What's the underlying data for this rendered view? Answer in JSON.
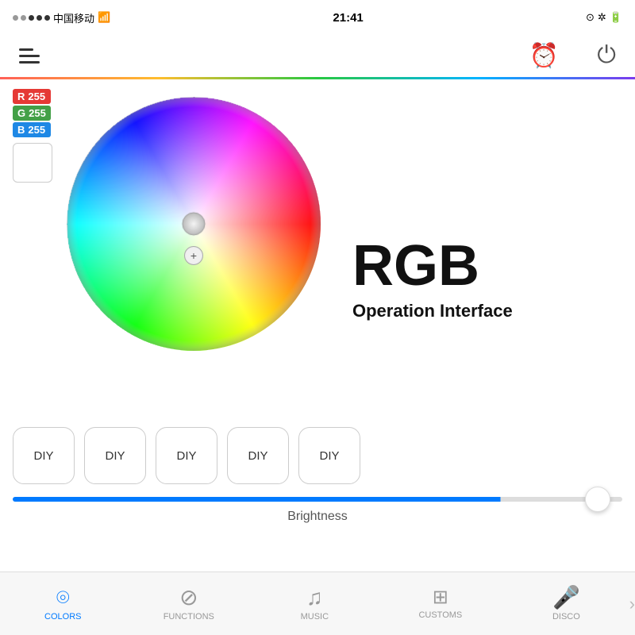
{
  "statusBar": {
    "carrier": "中国移动",
    "time": "21:41",
    "signalDots": [
      false,
      false,
      true,
      true,
      true
    ],
    "wifi": "wifi"
  },
  "navBar": {
    "menuLabel": "menu",
    "alarmLabel": "alarm",
    "powerLabel": "power"
  },
  "rgbLabels": [
    {
      "letter": "R",
      "value": "255",
      "class": "r"
    },
    {
      "letter": "G",
      "value": "255",
      "class": "g"
    },
    {
      "letter": "B",
      "value": "255",
      "class": "b"
    }
  ],
  "heading": {
    "title": "RGB",
    "subtitle": "Operation Interface"
  },
  "diyButtons": [
    "DIY",
    "DIY",
    "DIY",
    "DIY",
    "DIY"
  ],
  "brightness": {
    "label": "Brightness",
    "value": 80
  },
  "tabs": [
    {
      "id": "colors",
      "label": "COLORS",
      "icon": "🔵",
      "active": true
    },
    {
      "id": "functions",
      "label": "FUNCTIONS",
      "icon": "⊘"
    },
    {
      "id": "music",
      "label": "MUSIC",
      "icon": "♪"
    },
    {
      "id": "customs",
      "label": "CUSTOMS",
      "icon": "⊞"
    },
    {
      "id": "disco",
      "label": "DISCO",
      "icon": "🎤"
    }
  ]
}
